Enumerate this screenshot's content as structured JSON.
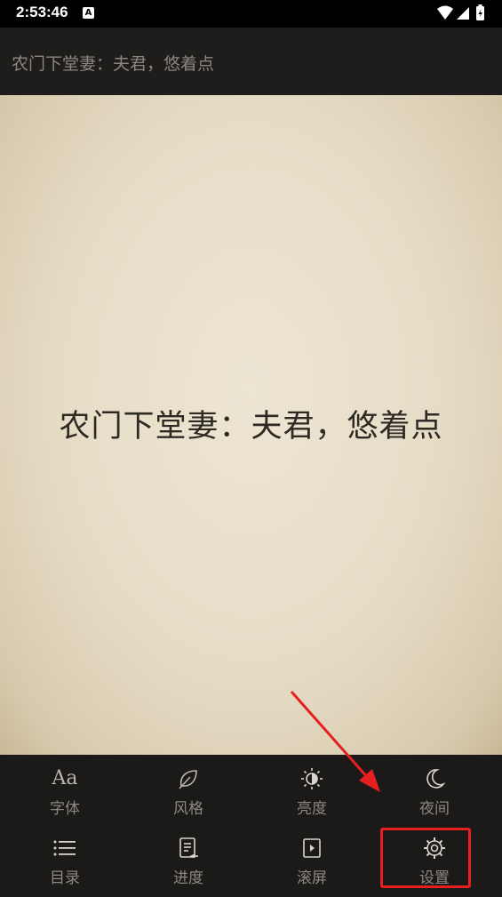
{
  "status_bar": {
    "time": "2:53:46",
    "notification_glyph": "A"
  },
  "header": {
    "title": "农门下堂妻：夫君，悠着点"
  },
  "page": {
    "book_title": "农门下堂妻：夫君，悠着点"
  },
  "menu": {
    "row1": [
      {
        "label": "字体",
        "icon": "font-icon"
      },
      {
        "label": "风格",
        "icon": "leaf-icon"
      },
      {
        "label": "亮度",
        "icon": "brightness-icon"
      },
      {
        "label": "夜间",
        "icon": "moon-icon"
      }
    ],
    "row2": [
      {
        "label": "目录",
        "icon": "list-icon"
      },
      {
        "label": "进度",
        "icon": "progress-icon"
      },
      {
        "label": "滚屏",
        "icon": "autoscroll-icon"
      },
      {
        "label": "设置",
        "icon": "settings-icon"
      }
    ],
    "font_glyph": "Aa"
  },
  "colors": {
    "annotation": "#e62020",
    "menu_background": "#1b1a19",
    "page_paper": "#e6dcc6"
  }
}
